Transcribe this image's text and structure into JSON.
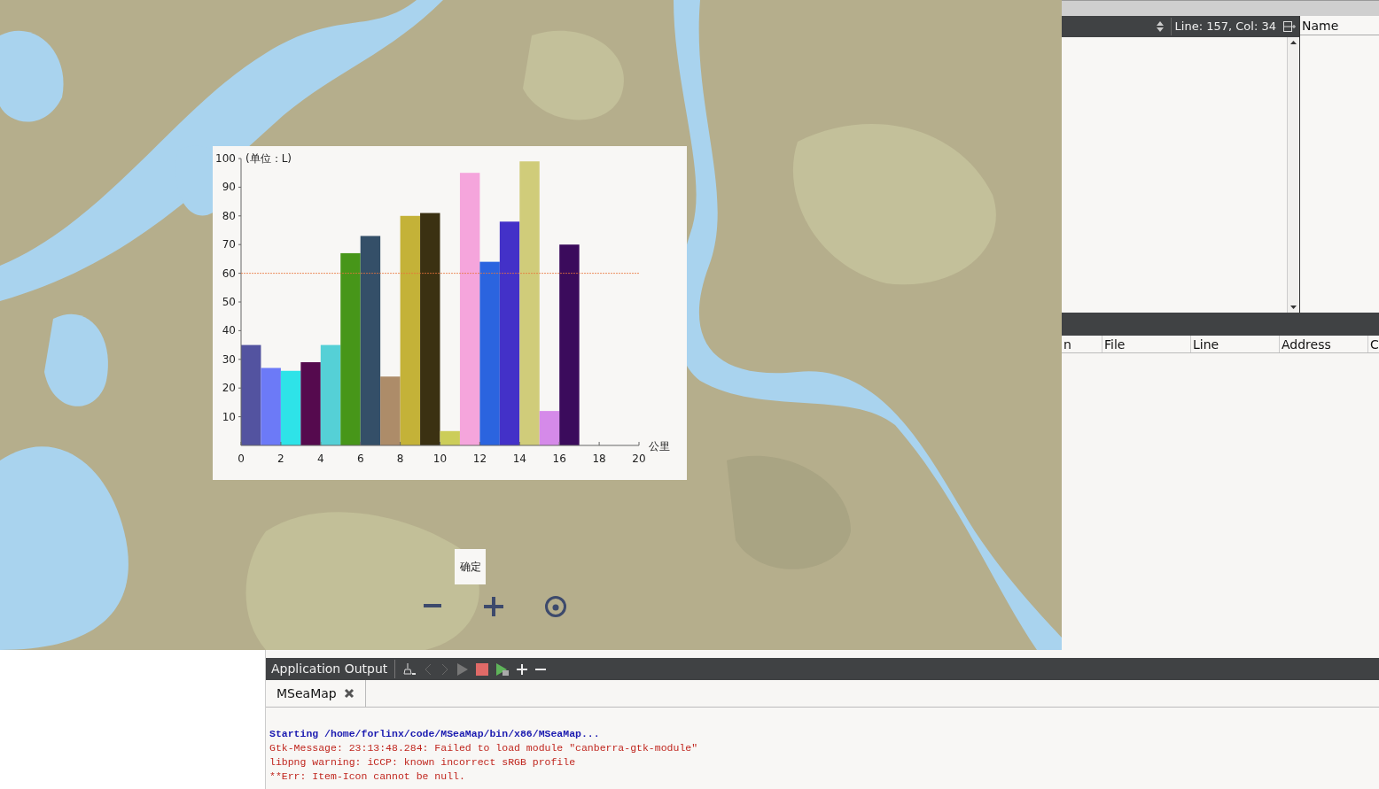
{
  "map": {
    "kind": "picture",
    "chart": {
      "unit_label": "(单位：L)",
      "x_unit": "公里",
      "chart_data": {
        "type": "bar",
        "x": [
          0.5,
          1.5,
          2.5,
          3.5,
          4.5,
          5.5,
          6.5,
          7.5,
          8.5,
          9.5,
          10.5,
          11.5,
          12.5,
          13.5,
          14.5,
          15.5,
          16.5
        ],
        "xlim": [
          0,
          20
        ],
        "ylim": [
          0,
          100
        ],
        "xticks": [
          0,
          2,
          4,
          6,
          8,
          10,
          12,
          14,
          16,
          18,
          20
        ],
        "yticks": [
          10,
          20,
          30,
          40,
          50,
          60,
          70,
          80,
          90,
          100
        ],
        "series": [
          {
            "values": [
              35,
              27,
              26,
              29,
              35,
              67,
              73,
              24,
              80,
              81,
              5,
              95,
              64,
              78,
              99,
              12,
              70
            ],
            "colors": [
              "#5353a0",
              "#6c7af7",
              "#2ee3e8",
              "#550a4e",
              "#55d0d6",
              "#479619",
              "#344f68",
              "#ad8c69",
              "#c4b238",
              "#3b3112",
              "#cccd59",
              "#f5a5dc",
              "#2b64df",
              "#4331c8",
              "#d0cc7a",
              "#d58ae9",
              "#3b0b5c"
            ]
          }
        ],
        "ref_lines": [
          {
            "axis": "y",
            "value": 60,
            "color": "#e8743b"
          }
        ]
      }
    },
    "confirm_button": "确定"
  },
  "editor": {
    "position": "Line: 157, Col: 34",
    "outline_header": "Name"
  },
  "stack_table": {
    "columns": [
      "n",
      "File",
      "Line",
      "Address",
      "C"
    ]
  },
  "output": {
    "title": "Application Output",
    "tabs": [
      {
        "label": "MSeaMap",
        "selected": true
      }
    ],
    "lines": [
      {
        "kind": "info",
        "text": "Starting /home/forlinx/code/MSeaMap/bin/x86/MSeaMap..."
      },
      {
        "kind": "error",
        "text": "Gtk-Message: 23:13:48.284: Failed to load module \"canberra-gtk-module\""
      },
      {
        "kind": "error",
        "text": "libpng warning: iCCP: known incorrect sRGB profile"
      },
      {
        "kind": "error",
        "text": "**Err: Item-Icon cannot be null."
      }
    ]
  }
}
